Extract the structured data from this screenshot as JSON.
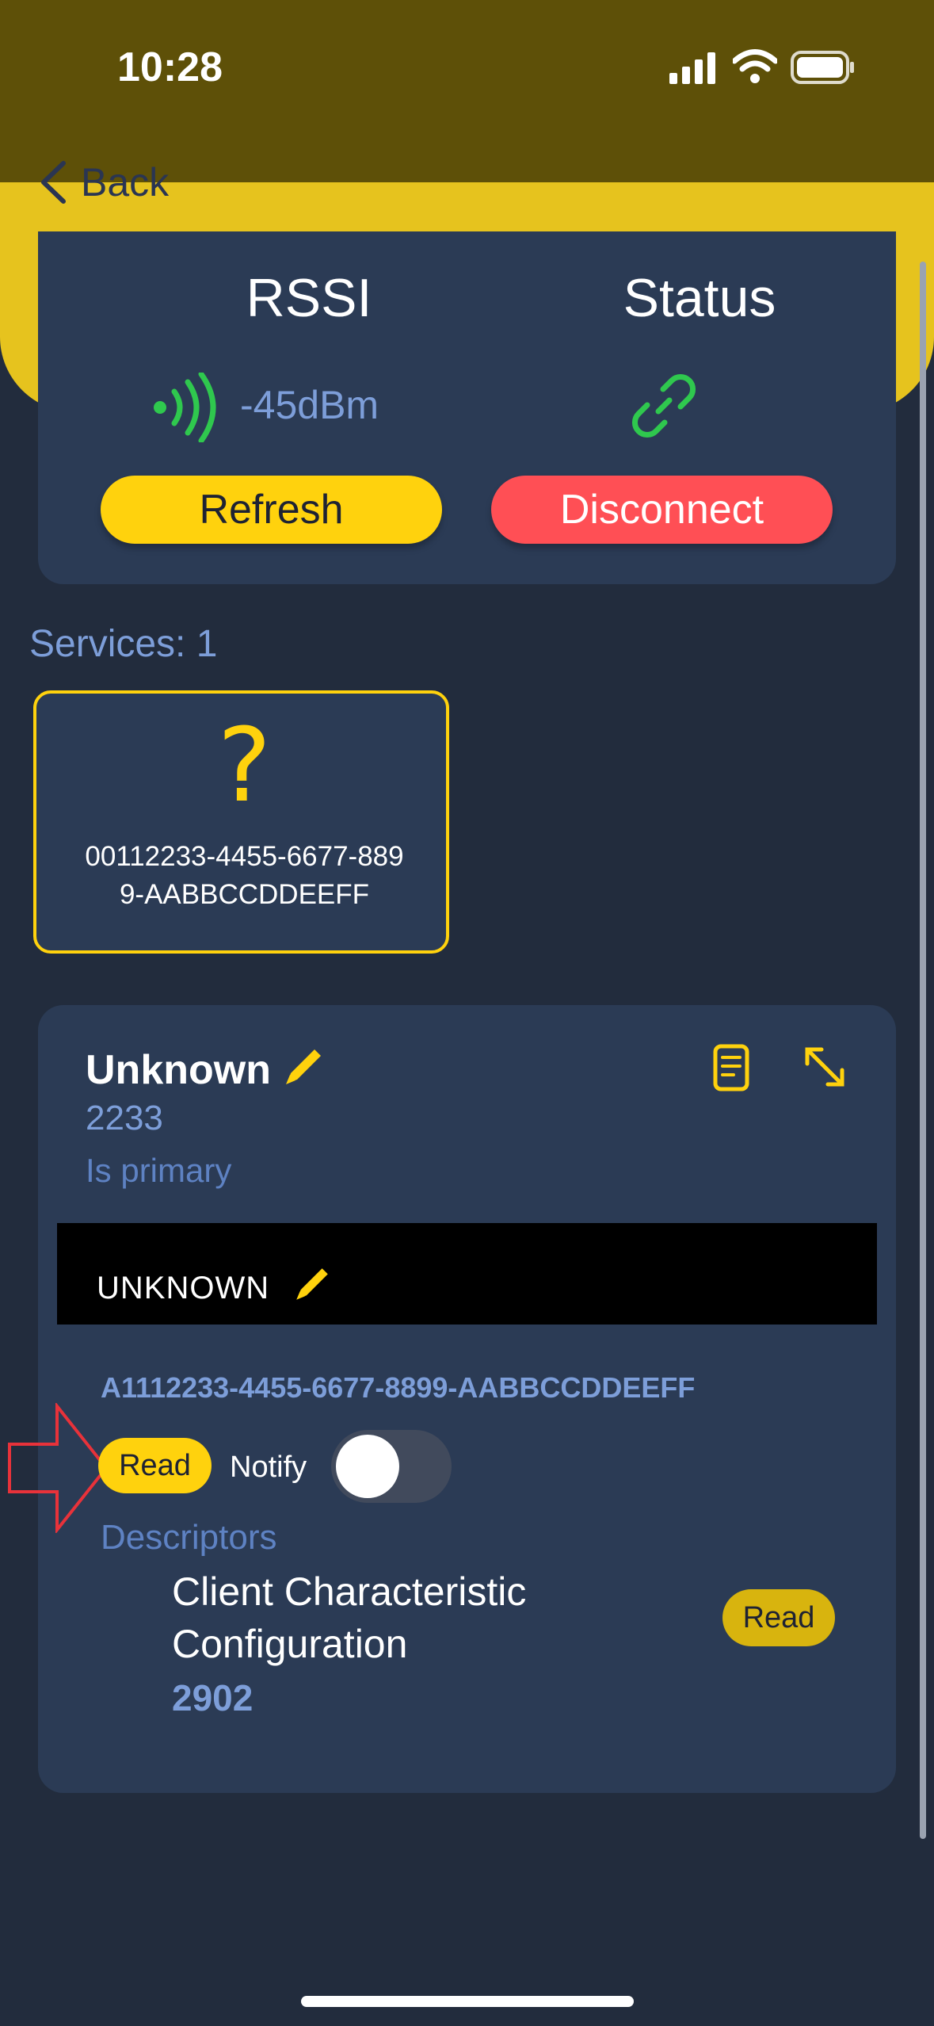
{
  "status_bar": {
    "time": "10:28"
  },
  "nav": {
    "back_label": "Back"
  },
  "connection": {
    "rssi_title": "RSSI",
    "rssi_value": "-45dBm",
    "status_title": "Status",
    "refresh_label": "Refresh",
    "disconnect_label": "Disconnect"
  },
  "services": {
    "count_label": "Services: 1",
    "tile": {
      "icon": "question-mark",
      "uuid_line1": "00112233-4455-6677-889",
      "uuid_line2": "9-AABBCCDDEEFF"
    }
  },
  "service_detail": {
    "name": "Unknown",
    "short_uuid": "2233",
    "primary_label": "Is primary",
    "characteristic": {
      "name": "UNKNOWN",
      "uuid": "A1112233-4455-6677-8899-AABBCCDDEEFF",
      "read_label": "Read",
      "notify_label": "Notify",
      "notify_on": false,
      "descriptors_label": "Descriptors",
      "descriptor": {
        "name_line1": "Client Characteristic",
        "name_line2": "Configuration",
        "uuid": "2902",
        "read_label": "Read"
      }
    }
  },
  "colors": {
    "accent_yellow": "#ffd20d",
    "danger_red": "#ff4f55",
    "signal_green": "#2fc84e",
    "card_bg": "#2b3b55",
    "page_bg": "#222c3d"
  }
}
